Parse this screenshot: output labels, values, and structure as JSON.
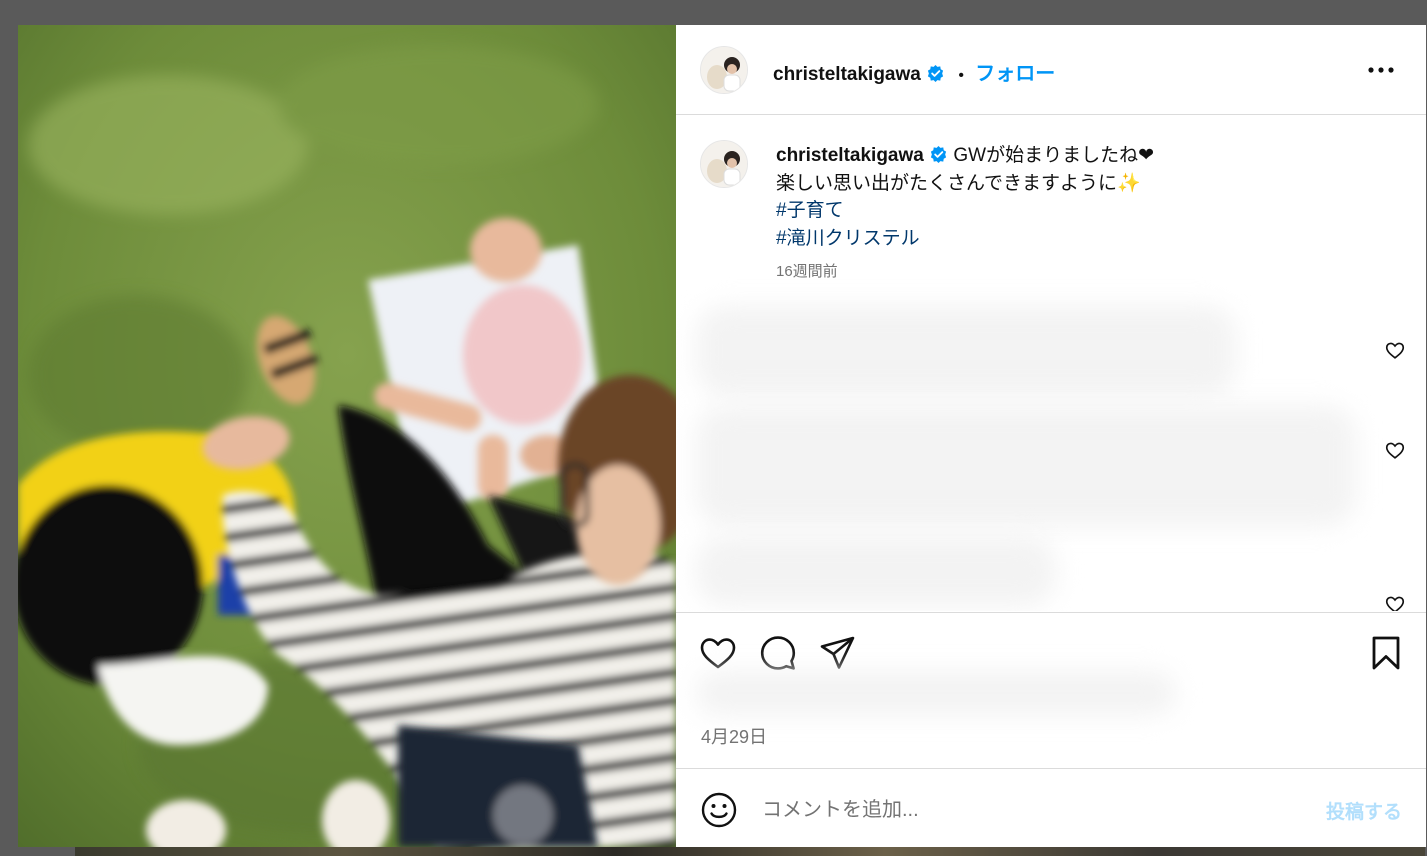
{
  "header": {
    "username": "christeltakigawa",
    "separator": "•",
    "follow_label": "フォロー"
  },
  "caption": {
    "username": "christeltakigawa",
    "line1": "GWが始まりましたね❤︎",
    "line2": "楽しい思い出がたくさんできますように✨",
    "hashtag1": "#子育て",
    "hashtag2": "#滝川クリステル",
    "time": "16週間前"
  },
  "footer": {
    "date": "4月29日"
  },
  "add_comment": {
    "placeholder": "コメントを追加...",
    "post_label": "投稿する"
  },
  "colors": {
    "link": "#0095f6",
    "hashtag": "#00376b",
    "verified": "#0095f6",
    "muted": "#737373"
  },
  "icons": [
    "verified-badge-icon",
    "more-options-icon",
    "heart-icon",
    "comment-icon",
    "share-icon",
    "bookmark-icon",
    "emoji-icon"
  ]
}
